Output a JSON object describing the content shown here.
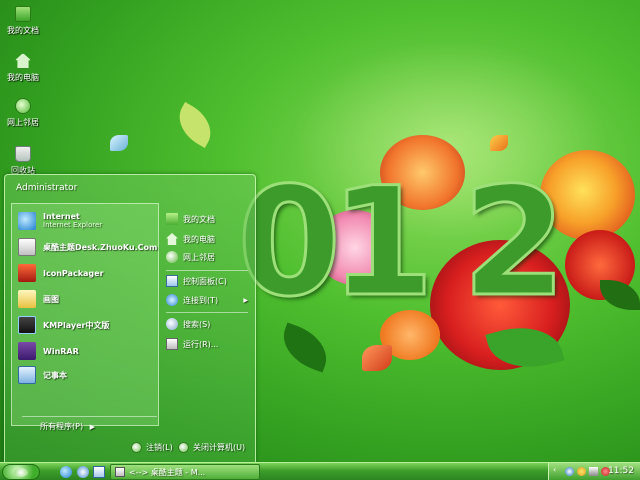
{
  "wallpaper": {
    "digits": [
      "0",
      "1",
      "2"
    ]
  },
  "desktop": {
    "icons": [
      {
        "label": "我的文档",
        "icon": "folder-icon"
      },
      {
        "label": "我的电脑",
        "icon": "computer-icon"
      },
      {
        "label": "网上邻居",
        "icon": "network-icon"
      },
      {
        "label": "回收站",
        "icon": "recycle-bin-icon"
      }
    ]
  },
  "start_menu": {
    "user": "Administrator",
    "programs": [
      {
        "label": "Internet",
        "sub": "Internet Explorer",
        "icon": "internet-explorer-icon"
      },
      {
        "label": "桌酷主题Desk.ZhuoKu.Com",
        "icon": "zhuoku-icon"
      },
      {
        "label": "IconPackager",
        "icon": "iconpackager-icon"
      },
      {
        "label": "画图",
        "icon": "paint-icon"
      },
      {
        "label": "KMPlayer中文版",
        "icon": "kmplayer-icon"
      },
      {
        "label": "WinRAR",
        "icon": "winrar-icon"
      },
      {
        "label": "记事本",
        "icon": "notepad-icon"
      }
    ],
    "all_programs": "所有程序(P)",
    "right_items": [
      {
        "label": "我的文档",
        "icon": "folder-icon"
      },
      {
        "label": "我的电脑",
        "icon": "computer-icon"
      },
      {
        "label": "网上邻居",
        "icon": "network-icon"
      },
      {
        "label": "控制面板(C)",
        "icon": "control-panel-icon"
      },
      {
        "label": "连接到(T)",
        "icon": "connect-icon"
      },
      {
        "label": "搜索(S)",
        "icon": "search-icon"
      },
      {
        "label": "运行(R)...",
        "icon": "run-icon"
      }
    ],
    "logoff": "注销(L)",
    "shutdown": "关闭计算机(U)"
  },
  "taskbar": {
    "task_label": "<--> 桌酷主题 - M...",
    "clock": "11:52"
  },
  "colors": {
    "taskbar": "#3e9e2b",
    "start_menu": "#6ec85a",
    "wallpaper": "#4fbf2f"
  }
}
